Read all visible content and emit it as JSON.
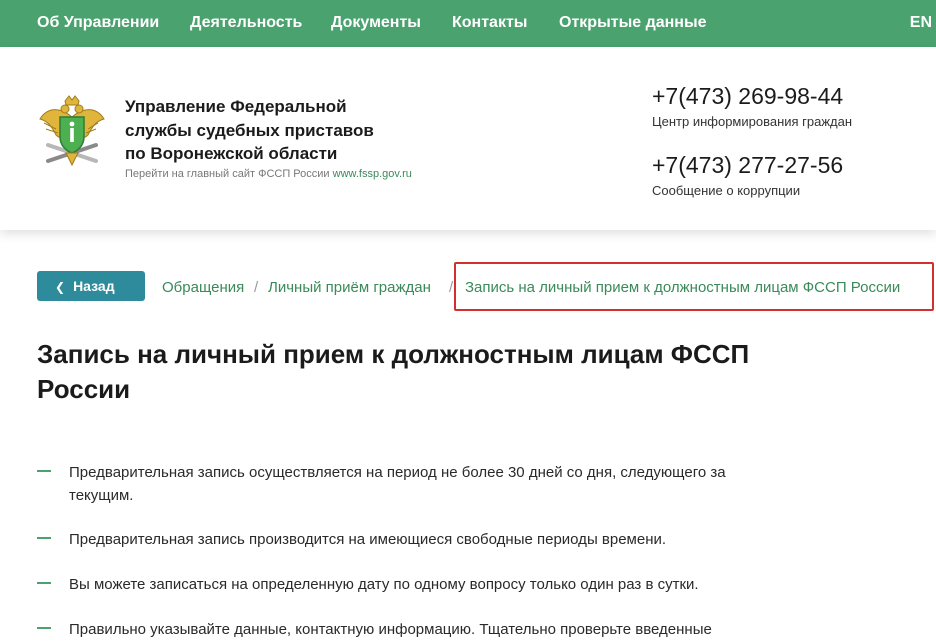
{
  "nav": {
    "items": [
      "Об Управлении",
      "Деятельность",
      "Документы",
      "Контакты",
      "Открытые данные"
    ],
    "lang": "EN"
  },
  "header": {
    "org_lines": [
      "Управление Федеральной",
      "службы судебных приставов",
      "по Воронежской области"
    ],
    "site_prefix": "Перейти на главный сайт ФССП России",
    "site_link": "www.fssp.gov.ru",
    "phones": [
      {
        "number": "+7(473) 269-98-44",
        "caption": "Центр информирования граждан"
      },
      {
        "number": "+7(473) 277-27-56",
        "caption": "Сообщение о коррупции"
      }
    ]
  },
  "back_label": "Назад",
  "breadcrumb": {
    "items": [
      "Обращения",
      "Личный приём граждан",
      "Запись на личный прием к должностным лицам ФССП России"
    ],
    "separator": "/"
  },
  "page_title_lines": [
    "Запись на личный прием к должностным лицам ФССП",
    "России"
  ],
  "rules": [
    [
      "Предварительная запись осуществляется на период не более 30 дней со дня, следующего за",
      "текущим."
    ],
    [
      "Предварительная запись производится на имеющиеся свободные периоды времени."
    ],
    [
      "Вы можете записаться на определенную дату по одному вопросу только один раз в сутки."
    ],
    [
      "Правильно указывайте данные, контактную информацию. Тщательно проверьте введенные"
    ]
  ],
  "colors": {
    "nav_bg": "#4aa26e",
    "accent": "#3a8a5a",
    "button": "#2e8b9c",
    "highlight": "#d32f2f"
  }
}
